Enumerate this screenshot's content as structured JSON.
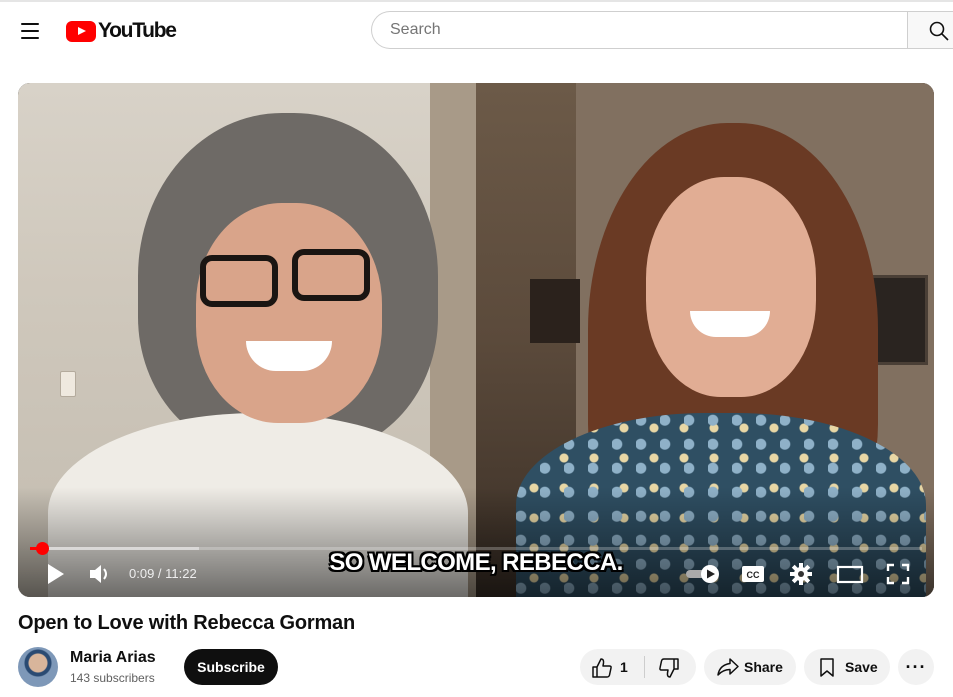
{
  "header": {
    "logo_text": "YouTube",
    "search_placeholder": "Search"
  },
  "player": {
    "caption": "SO WELCOME, REBECCA.",
    "current_time": "0:09",
    "separator": " / ",
    "duration": "11:22",
    "progress": {
      "played_fraction": 0.013,
      "loaded_fraction": 0.19
    }
  },
  "video": {
    "title": "Open to Love with Rebecca Gorman"
  },
  "channel": {
    "name": "Maria Arias",
    "subscribers": "143 subscribers",
    "subscribe_label": "Subscribe"
  },
  "actions": {
    "like_count": "1",
    "share_label": "Share",
    "save_label": "Save",
    "more_label": "···"
  },
  "colors": {
    "brand_red": "#ff0000",
    "text_primary": "#0f0f0f",
    "text_secondary": "#606060",
    "pill_bg": "#f2f2f2"
  }
}
